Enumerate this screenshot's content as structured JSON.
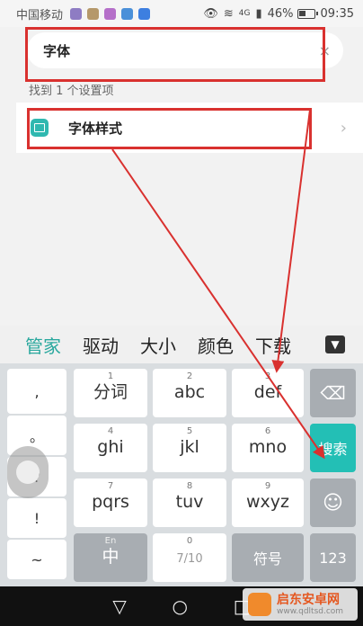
{
  "status": {
    "carrier": "中国移动",
    "network": "4G",
    "battery": "46%",
    "battery_level": 0.46,
    "time": "09:35"
  },
  "search": {
    "value": "字体",
    "clear_icon": "×"
  },
  "results": {
    "count_label": "找到 1 个设置项",
    "items": [
      {
        "label": "字体样式",
        "chevron": "›"
      }
    ]
  },
  "ime": {
    "candidates": [
      "管家",
      "驱动",
      "大小",
      "颜色",
      "下载"
    ],
    "toggle_icon": "▼",
    "left_symbols": [
      ",",
      "。",
      "?",
      "!",
      "~"
    ],
    "keys": [
      {
        "sub": "1",
        "main": "分词"
      },
      {
        "sub": "2",
        "main": "abc"
      },
      {
        "sub": "3",
        "main": "def"
      },
      {
        "sub": "4",
        "main": "ghi"
      },
      {
        "sub": "5",
        "main": "jkl"
      },
      {
        "sub": "6",
        "main": "mno"
      },
      {
        "sub": "7",
        "main": "pqrs"
      },
      {
        "sub": "8",
        "main": "tuv"
      },
      {
        "sub": "9",
        "main": "wxyz"
      }
    ],
    "backspace_icon": "⌫",
    "search_key": "搜索",
    "emoji_icon": "☺",
    "lang_sub": "En",
    "lang_main": "中",
    "space_sub": "0",
    "space_counter": "7/10",
    "symbols_key": "符号",
    "numbers_key": "123"
  },
  "nav": {
    "back": "▽",
    "home": "○",
    "recent": "□"
  },
  "watermark": {
    "title": "启东安卓网",
    "url": "www.qdltsd.com"
  },
  "colors": {
    "accent": "#23bfb5",
    "highlight": "#d9312f"
  }
}
